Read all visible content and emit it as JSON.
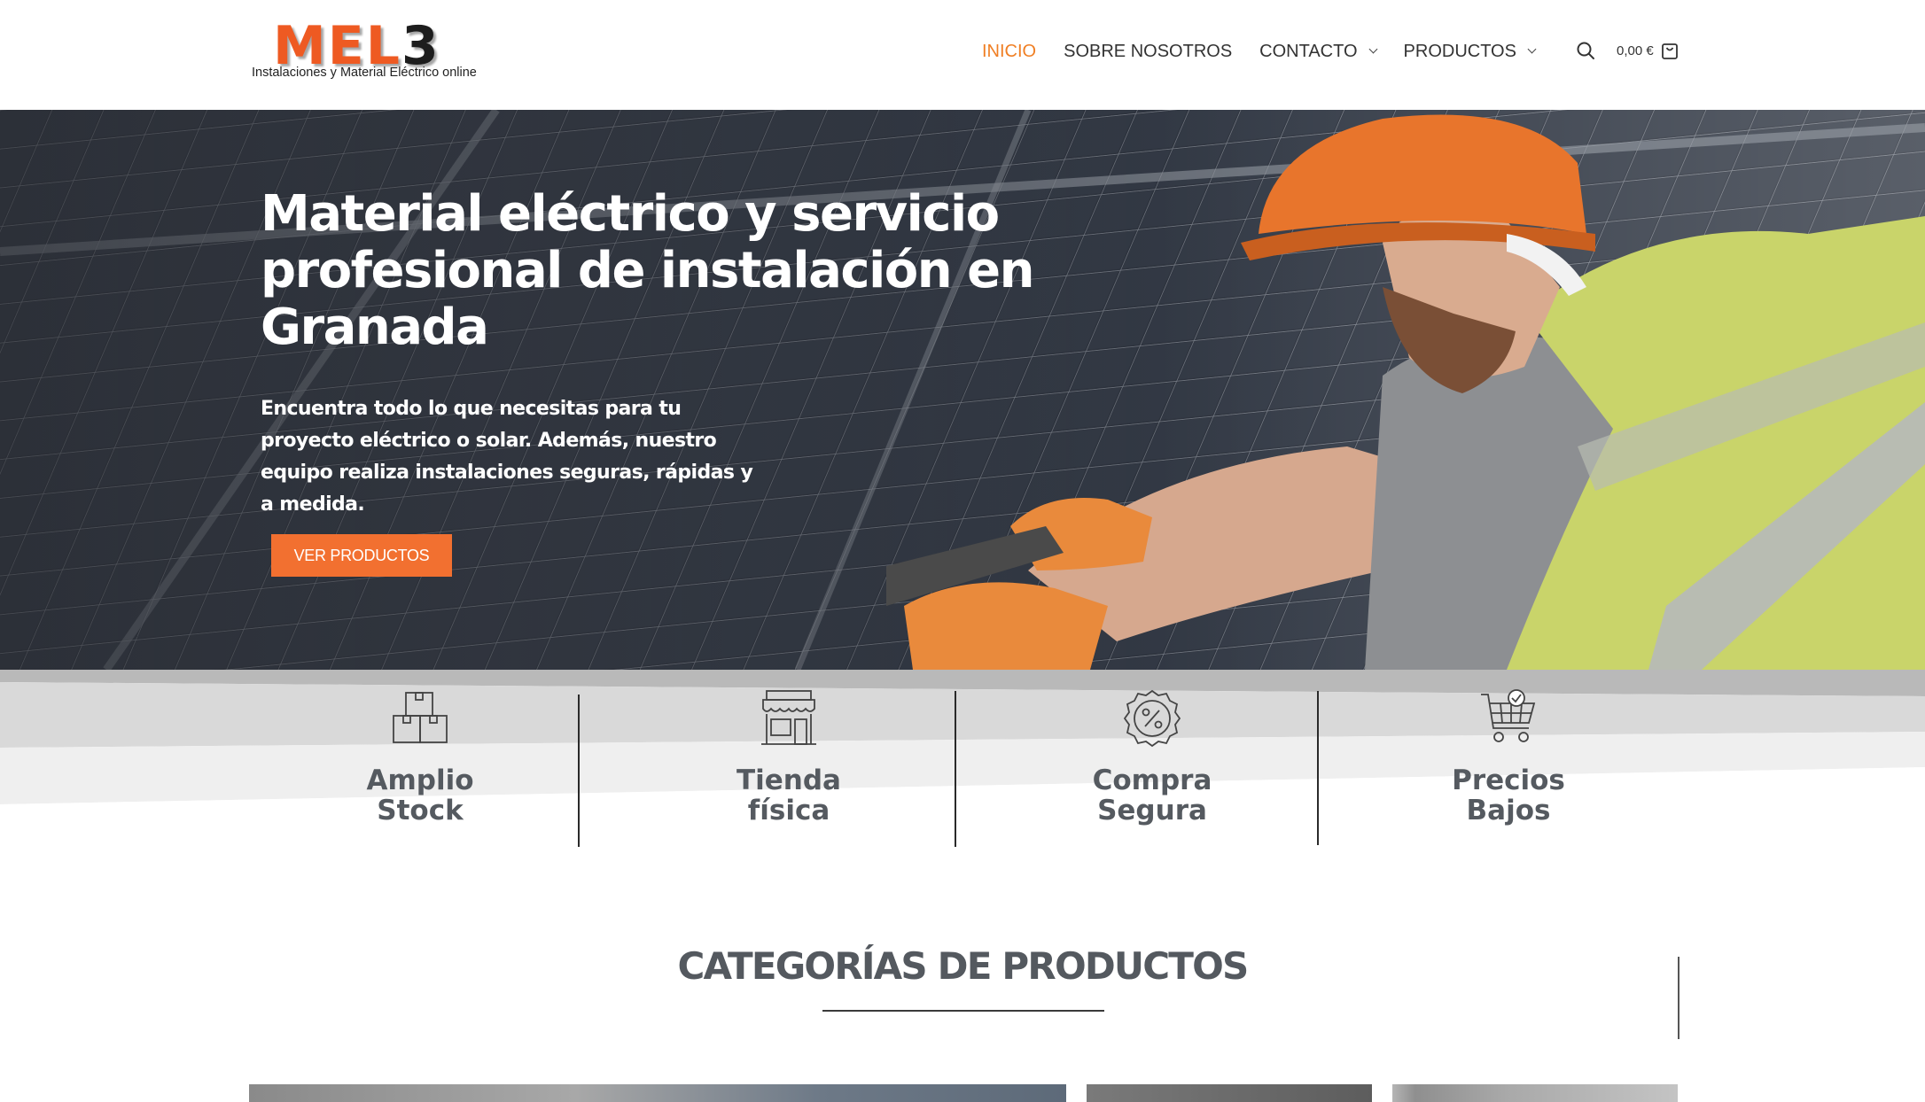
{
  "logo": {
    "wordmark_main": "MEL",
    "wordmark_number": "3",
    "tagline": "Instalaciones y Material Eléctrico online"
  },
  "nav": {
    "items": [
      {
        "label": "INICIO",
        "active": true,
        "has_dropdown": false
      },
      {
        "label": "SOBRE NOSOTROS",
        "active": false,
        "has_dropdown": false
      },
      {
        "label": "CONTACTO",
        "active": false,
        "has_dropdown": true
      },
      {
        "label": "PRODUCTOS",
        "active": false,
        "has_dropdown": true
      }
    ],
    "search_icon": "search-icon",
    "cart_total": "0,00 €",
    "cart_icon": "shopping-bag-icon"
  },
  "hero": {
    "title": "Material eléctrico y servicio profesional de instalación en Granada",
    "text": "Encuentra todo lo que necesitas para tu proyecto eléctrico o solar. Además, nuestro equipo realiza instalaciones seguras, rápidas y a medida.",
    "button_label": "VER PRODUCTOS"
  },
  "features": [
    {
      "label": "Amplio\nStock",
      "icon": "boxes-icon"
    },
    {
      "label": "Tienda\nfísica",
      "icon": "storefront-icon"
    },
    {
      "label": "Compra\nSegura",
      "icon": "percent-badge-icon"
    },
    {
      "label": "Precios\nBajos",
      "icon": "shopping-cart-icon"
    }
  ],
  "categories": {
    "title": "CATEGORÍAS DE PRODUCTOS"
  },
  "colors": {
    "accent": "#f07f24",
    "button": "#f27030",
    "heading": "#54595f"
  }
}
